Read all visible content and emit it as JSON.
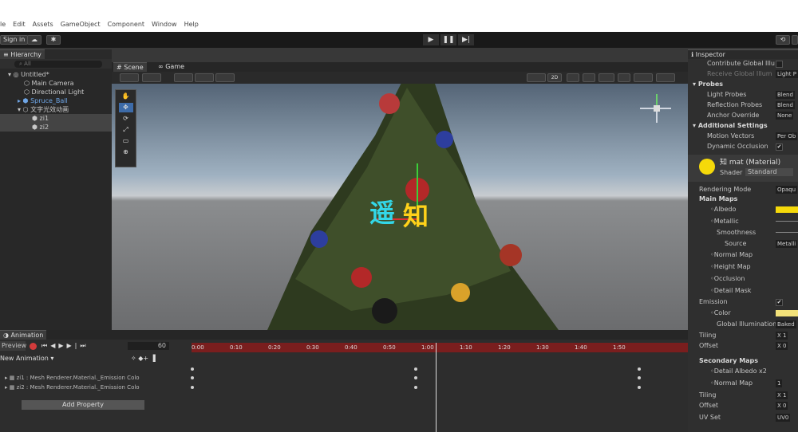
{
  "menu": [
    "le",
    "Edit",
    "Assets",
    "GameObject",
    "Component",
    "Window",
    "Help"
  ],
  "toolbar": {
    "signin": "Sign in"
  },
  "hierarchy": {
    "tab": "Hierarchy",
    "search_placeholder": "All",
    "items": [
      {
        "label": "Untitled*",
        "indent": 0
      },
      {
        "label": "Main Camera",
        "indent": 1
      },
      {
        "label": "Directional Light",
        "indent": 1
      },
      {
        "label": "Spruce_Ball",
        "indent": 1
      },
      {
        "label": "文字光效动画",
        "indent": 1
      },
      {
        "label": "zi1",
        "indent": 2
      },
      {
        "label": "zi2",
        "indent": 2
      }
    ]
  },
  "scene": {
    "tab_scene": "Scene",
    "tab_game": "Game",
    "btn_2d": "2D",
    "text_left": "遥",
    "text_right": "知"
  },
  "animation": {
    "tab": "Animation",
    "preview": "Preview",
    "frame": "60",
    "clip": "New Animation",
    "ticks": [
      "0:00",
      "0:10",
      "0:20",
      "0:30",
      "0:40",
      "0:50",
      "1:00",
      "1:10",
      "1:20",
      "1:30",
      "1:40",
      "1:50"
    ],
    "tracks": [
      "zi1 : Mesh Renderer.Material._Emission Colo",
      "zi2 : Mesh Renderer.Material._Emission Colo"
    ],
    "add_property": "Add Property"
  },
  "inspector": {
    "tab": "Inspector",
    "rows": [
      {
        "label": "Contribute Global Illu",
        "value": ""
      },
      {
        "label": "Receive Global Illum",
        "value": "Light P"
      },
      {
        "label": "Probes",
        "header": true
      },
      {
        "label": "Light Probes",
        "value": "Blend"
      },
      {
        "label": "Reflection Probes",
        "value": "Blend"
      },
      {
        "label": "Anchor Override",
        "value": "None"
      },
      {
        "label": "Additional Settings",
        "header": true
      },
      {
        "label": "Motion Vectors",
        "value": "Per Ob"
      },
      {
        "label": "Dynamic Occlusion",
        "value": "✔"
      }
    ],
    "material": {
      "name": "知 mat (Material)",
      "shader_label": "Shader",
      "shader": "Standard"
    },
    "mat_rows": [
      {
        "label": "Rendering Mode",
        "value": "Opaqu"
      },
      {
        "label": "Main Maps",
        "header": true
      },
      {
        "label": "Albedo",
        "value": ""
      },
      {
        "label": "Metallic",
        "value": ""
      },
      {
        "label": "Smoothness",
        "value": ""
      },
      {
        "label": "Source",
        "value": "Metalli"
      },
      {
        "label": "Normal Map",
        "value": ""
      },
      {
        "label": "Height Map",
        "value": ""
      },
      {
        "label": "Occlusion",
        "value": ""
      },
      {
        "label": "Detail Mask",
        "value": ""
      },
      {
        "label": "Emission",
        "value": "✔"
      },
      {
        "label": "Color",
        "value": ""
      },
      {
        "label": "Global Illumination",
        "value": "Baked"
      },
      {
        "label": "Tiling",
        "value": "X 1"
      },
      {
        "label": "Offset",
        "value": "X 0"
      },
      {
        "label": "Secondary Maps",
        "header": true
      },
      {
        "label": "Detail Albedo x2",
        "value": ""
      },
      {
        "label": "Normal Map",
        "value": "1"
      },
      {
        "label": "Tiling",
        "value": "X 1"
      },
      {
        "label": "Offset",
        "value": "X 0"
      },
      {
        "label": "UV Set",
        "value": "UV0"
      }
    ]
  },
  "colors": {
    "accent": "#2f6fbd",
    "timeline": "#7a1e1e",
    "albedo": "#f5d90a",
    "emission": "#f3e27a"
  }
}
